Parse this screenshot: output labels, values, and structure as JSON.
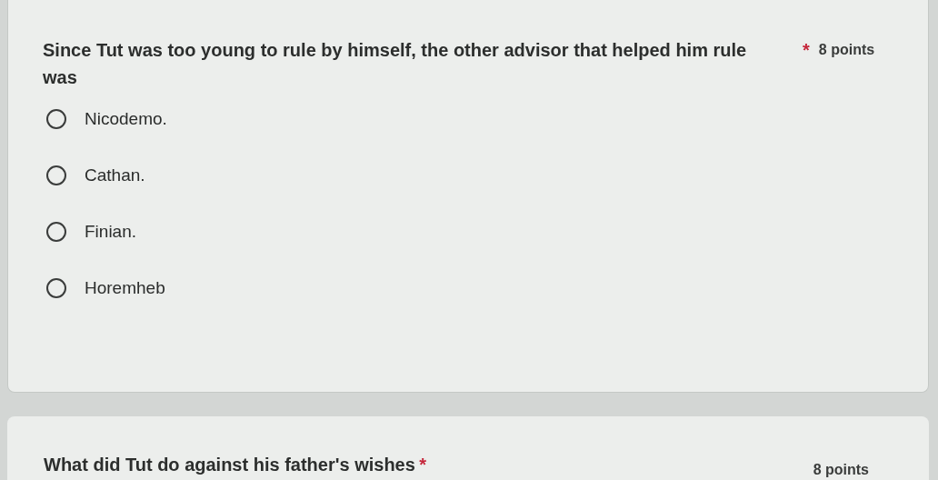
{
  "questions": [
    {
      "title": "Since Tut was too young to rule by himself, the other advisor that helped him rule was",
      "required_mark": "*",
      "points": "8 points",
      "options": [
        {
          "label": "Nicodemo.",
          "selected": false
        },
        {
          "label": "Cathan.",
          "selected": false
        },
        {
          "label": "Finian.",
          "selected": false
        },
        {
          "label": "Horemheb",
          "selected": false
        }
      ]
    },
    {
      "title": "What did Tut do against his father's wishes",
      "required_mark": "*",
      "points": "8 points"
    }
  ]
}
